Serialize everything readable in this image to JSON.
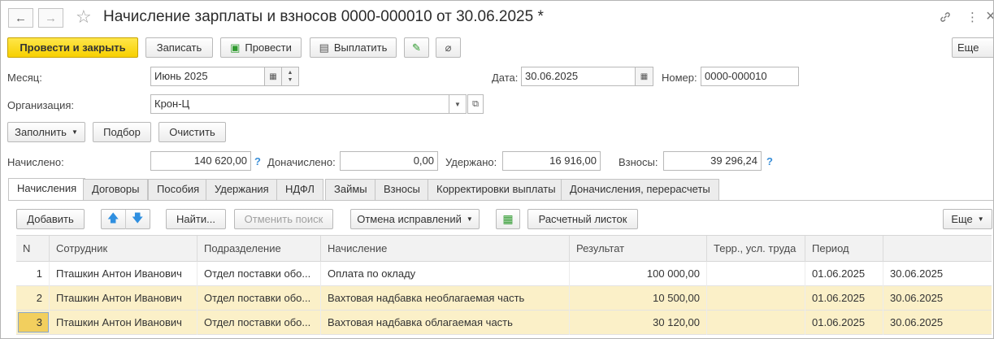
{
  "window": {
    "title": "Начисление зарплаты и взносов 0000-000010 от 30.06.2025 *"
  },
  "icons": {
    "back": "←",
    "forward": "→",
    "star": "☆",
    "link": "🔗",
    "kebab": "⋮",
    "close": "×"
  },
  "toolbar": {
    "post_and_close": "Провести и закрыть",
    "save": "Записать",
    "post": "Провести",
    "pay": "Выплатить",
    "more": "Еще"
  },
  "header": {
    "month_label": "Месяц:",
    "month_value": "Июнь 2025",
    "date_label": "Дата:",
    "date_value": "30.06.2025",
    "number_label": "Номер:",
    "number_value": "0000-000010",
    "org_label": "Организация:",
    "org_value": "Крон-Ц"
  },
  "actions": {
    "fill": "Заполнить",
    "pick": "Подбор",
    "clear": "Очистить"
  },
  "totals": {
    "accrued_label": "Начислено:",
    "accrued_value": "140 620,00",
    "additional_label": "Доначислено:",
    "additional_value": "0,00",
    "withheld_label": "Удержано:",
    "withheld_value": "16 916,00",
    "contrib_label": "Взносы:",
    "contrib_value": "39 296,24",
    "help": "?"
  },
  "tabs": [
    {
      "label": "Начисления"
    },
    {
      "label": "Договоры"
    },
    {
      "label": "Пособия"
    },
    {
      "label": "Удержания"
    },
    {
      "label": "НДФЛ"
    },
    {
      "label": "Займы"
    },
    {
      "label": "Взносы"
    },
    {
      "label": "Корректировки выплаты"
    },
    {
      "label": "Доначисления, перерасчеты"
    }
  ],
  "table_toolbar": {
    "add": "Добавить",
    "find": "Найти...",
    "cancel_search": "Отменить поиск",
    "cancel_corrections": "Отмена исправлений",
    "payslip": "Расчетный листок",
    "more": "Еще"
  },
  "table": {
    "columns": [
      "N",
      "Сотрудник",
      "Подразделение",
      "Начисление",
      "Результат",
      "Терр., усл. труда",
      "Период",
      ""
    ],
    "rows": [
      {
        "n": "1",
        "employee": "Пташкин Антон Иванович",
        "dept": "Отдел поставки обо...",
        "accrual": "Оплата по окладу",
        "result": "100 000,00",
        "terr": "",
        "from": "01.06.2025",
        "to": "30.06.2025"
      },
      {
        "n": "2",
        "employee": "Пташкин Антон Иванович",
        "dept": "Отдел поставки обо...",
        "accrual": "Вахтовая надбавка необлагаемая часть",
        "result": "10 500,00",
        "terr": "",
        "from": "01.06.2025",
        "to": "30.06.2025"
      },
      {
        "n": "3",
        "employee": "Пташкин Антон Иванович",
        "dept": "Отдел поставки обо...",
        "accrual": "Вахтовая надбавка облагаемая часть",
        "result": "30 120,00",
        "terr": "",
        "from": "01.06.2025",
        "to": "30.06.2025"
      }
    ]
  }
}
